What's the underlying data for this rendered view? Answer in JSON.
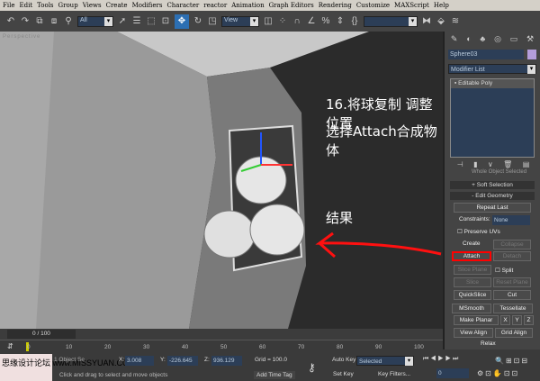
{
  "menu": [
    "File",
    "Edit",
    "Tools",
    "Group",
    "Views",
    "Create",
    "Modifiers",
    "Character",
    "reactor",
    "Animation",
    "Graph Editors",
    "Rendering",
    "Customize",
    "MAXScript",
    "Help"
  ],
  "toolbar": {
    "selection_filter": "All",
    "ref_coord": "View"
  },
  "viewport": {
    "label": "Perspective",
    "note_line1": "16.将球复制 调整位置",
    "note_line2": "选择Attach合成物体",
    "note_result": "结果"
  },
  "panel": {
    "object_name": "Sphere03",
    "object_color": "#b39ddb",
    "modifier_list": "Modifier List",
    "stack_item": "Editable Poly",
    "rollout_hidden": "Whole Object Selected",
    "soft_selection": "Soft Selection",
    "edit_geometry": "Edit Geometry",
    "repeat_last": "Repeat Last",
    "constraints_label": "Constraints:",
    "constraints_value": "None",
    "preserve_uvs": "Preserve UVs",
    "create": "Create",
    "collapse": "Collapse",
    "attach": "Attach",
    "detach": "Detach",
    "slice_plane": "Slice Plane",
    "split": "Split",
    "slice": "Slice",
    "reset_plane": "Reset Plane",
    "quickslice": "QuickSlice",
    "cut": "Cut",
    "msmooth": "MSmooth",
    "tessellate": "Tessellate",
    "make_planar": "Make Planar",
    "x": "X",
    "y": "Y",
    "z": "Z",
    "view_align": "View Align",
    "grid_align": "Grid Align",
    "relax": "Relax"
  },
  "timeline": {
    "frame": "0 / 100",
    "ticks": [
      "0",
      "10",
      "20",
      "30",
      "40",
      "50",
      "60",
      "70",
      "80",
      "90",
      "100"
    ]
  },
  "status": {
    "selection": "1 Object Se",
    "x_label": "X:",
    "x": "3.008",
    "y_label": "Y:",
    "y": "-226.645",
    "z_label": "Z:",
    "z": "936.129",
    "grid": "Grid = 100.0",
    "prompt": "Click and drag to select and move objects",
    "add_time_tag": "Add Time Tag",
    "auto_key": "Auto Key",
    "set_key": "Set Key",
    "key_mode": "Selected",
    "key_filters": "Key Filters...",
    "current_frame": "0",
    "watermark": "思缘设计论坛 www.MISSYUAN.COM"
  }
}
